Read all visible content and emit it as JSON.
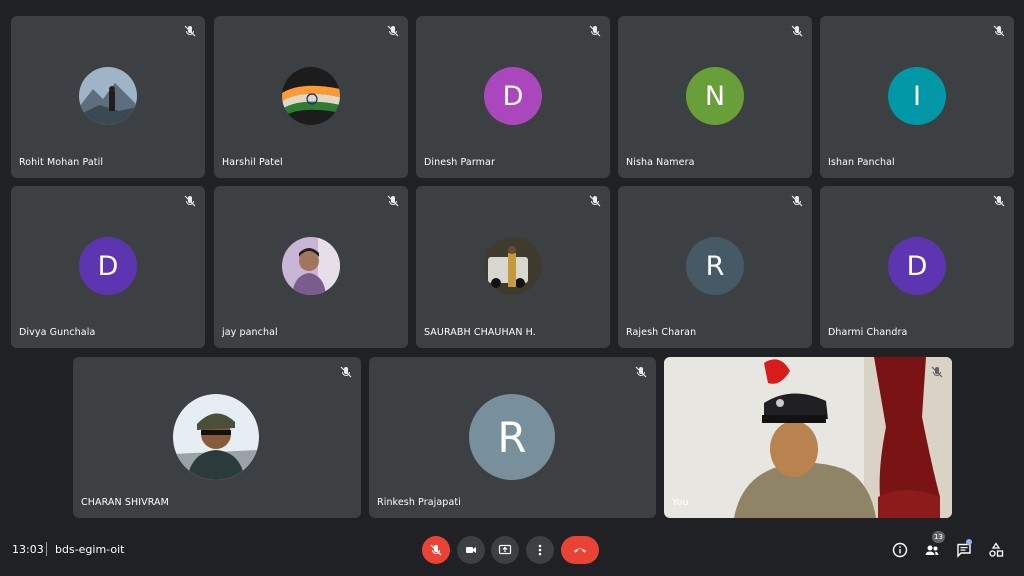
{
  "participants": [
    {
      "name": "Rohit Mohan Patil",
      "initial": "",
      "avatar_color": "#7a8fa6",
      "avatar_kind": "photo-mountain"
    },
    {
      "name": "Harshil Patel",
      "initial": "",
      "avatar_color": "#2a2a2a",
      "avatar_kind": "photo-flag"
    },
    {
      "name": "Dinesh Parmar",
      "initial": "D",
      "avatar_color": "#ab47bc"
    },
    {
      "name": "Nisha Namera",
      "initial": "N",
      "avatar_color": "#689f38"
    },
    {
      "name": "Ishan Panchal",
      "initial": "I",
      "avatar_color": "#0097a7"
    },
    {
      "name": "Divya Gunchala",
      "initial": "D",
      "avatar_color": "#5e35b1"
    },
    {
      "name": "jay panchal",
      "initial": "",
      "avatar_color": "#b39ddb",
      "avatar_kind": "photo-person"
    },
    {
      "name": "SAURABH CHAUHAN H.",
      "initial": "",
      "avatar_color": "#3e3a2e",
      "avatar_kind": "photo-jeep"
    },
    {
      "name": "Rajesh Charan",
      "initial": "R",
      "avatar_color": "#455a64"
    },
    {
      "name": "Dharmi Chandra",
      "initial": "D",
      "avatar_color": "#5e35b1"
    },
    {
      "name": "CHARAN SHIVRAM",
      "initial": "",
      "avatar_color": "#e8eef3",
      "avatar_kind": "photo-cap"
    },
    {
      "name": "Rinkesh Prajapati",
      "initial": "R",
      "avatar_color": "#78909c"
    }
  ],
  "self_tile": {
    "name": "You"
  },
  "meeting": {
    "time": "13:03",
    "code": "bds-egim-oit"
  },
  "controls": {
    "mic": "mic-off-icon",
    "camera": "videocam-icon",
    "present": "present-screen-icon",
    "more": "more-vert-icon",
    "hangup": "call-end-icon"
  },
  "people_count": "13",
  "colors": {
    "background": "#202124",
    "tile": "#3c4043",
    "danger": "#ea4335",
    "accent": "#8ab4f8"
  }
}
